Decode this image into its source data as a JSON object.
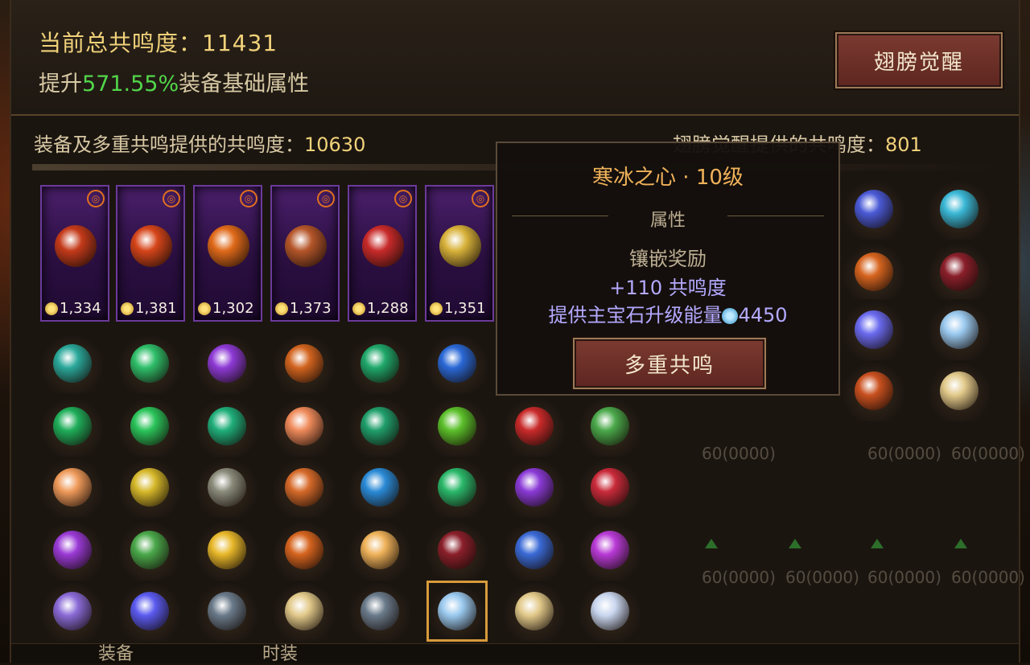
{
  "header": {
    "total_label": "当前总共鸣度：11431",
    "boost_prefix": "提升",
    "boost_pct": "571.55%",
    "boost_suffix": "装备基础属性",
    "wing_button": "翅膀觉醒"
  },
  "sub": {
    "left_label": "装备及多重共鸣提供的共鸣度：",
    "left_value": "10630",
    "right_label": "翅膀觉醒提供的共鸣度：",
    "right_value": "801"
  },
  "cards": [
    {
      "cost": "1,334",
      "color": "#c43a1a"
    },
    {
      "cost": "1,381",
      "color": "#d6451a"
    },
    {
      "cost": "1,302",
      "color": "#e06a1a"
    },
    {
      "cost": "1,373",
      "color": "#b5562a"
    },
    {
      "cost": "1,288",
      "color": "#c82a2a"
    },
    {
      "cost": "1,351",
      "color": "#d8b23a"
    }
  ],
  "gems": [
    [
      "#2aa89a",
      "#2fbf6a",
      "#8e3ad6",
      "#d2641f",
      "#1fa86a",
      "#2a68d6",
      "",
      ""
    ],
    [
      "#1fae5a",
      "#2ac45a",
      "#1fae7a",
      "#ef8a5a",
      "#1f9e6a",
      "#5bbf2a",
      "#c92a2a",
      "#4aa84a"
    ],
    [
      "#ef9a5a",
      "#d6b82a",
      "#8a8a7a",
      "#d66a2a",
      "#2a8ad6",
      "#2ab86a",
      "#8a3ad6",
      "#c92a3a"
    ],
    [
      "#9a3ad6",
      "#4aa84a",
      "#e8b82a",
      "#d6641f",
      "#efb25a",
      "#8a1f2a",
      "#3a6ad6",
      "#b83ad6"
    ],
    [
      "#8a6ad6",
      "#5a5aef",
      "#6a7a8a",
      "#e2c98a",
      "#6a7a8a",
      "#9ac9ef",
      "#e2c98a",
      "#c9d6ef"
    ]
  ],
  "right_gems": [
    [
      "#4a5ad6",
      "#3ab8d6"
    ],
    [
      "#d6641f",
      "#8a1f2a"
    ],
    [
      "#6a6aef",
      "#9ac9ef"
    ],
    [
      "#c9501f",
      "#e2c98a"
    ]
  ],
  "faint_rows": {
    "row1_text": "60(0000)",
    "row2_text": "60(0000)"
  },
  "tooltip": {
    "title": "寒冰之心 · 10级",
    "attr": "属性",
    "bonus": "镶嵌奖励",
    "resonance": "+110 共鸣度",
    "energy_label": "提供主宝石升级能量",
    "energy_value": "4450",
    "multi_button": "多重共鸣"
  },
  "tabs": {
    "equip": "装备",
    "fashion": "时装"
  }
}
